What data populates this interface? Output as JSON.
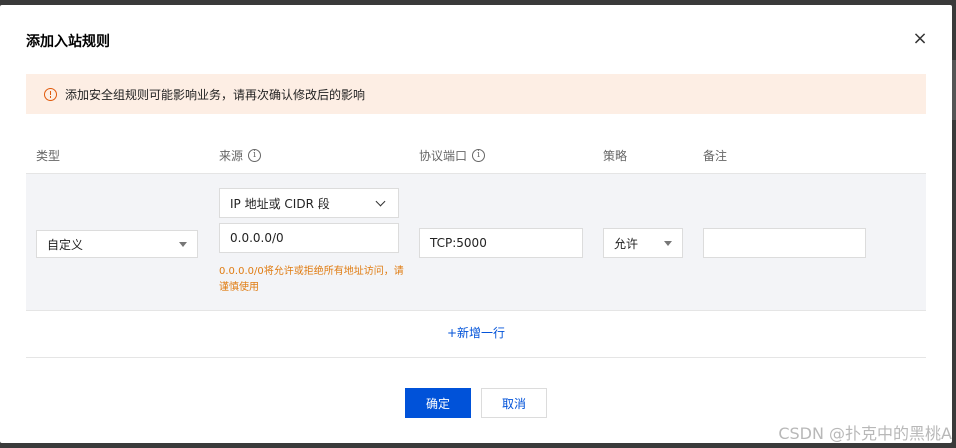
{
  "dialog": {
    "title": "添加入站规则",
    "close_symbol": "×"
  },
  "alert": {
    "icon": "warning-circle-icon",
    "text": "添加安全组规则可能影响业务，请再次确认修改后的影响",
    "color": "#e05a0c",
    "background": "#fdeee4"
  },
  "table": {
    "headers": {
      "type": "类型",
      "source": "来源",
      "port": "协议端口",
      "policy": "策略",
      "note": "备注"
    },
    "info_symbol": "i",
    "row": {
      "type_value": "自定义",
      "source_kind": "IP 地址或 CIDR 段",
      "source_value": "0.0.0.0/0",
      "source_warning": "0.0.0.0/0将允许或拒绝所有地址访问，请谨慎使用",
      "port_value": "TCP:5000",
      "policy_value": "允许",
      "note_value": ""
    }
  },
  "add_row_label": "+新增一行",
  "footer": {
    "ok_label": "确定",
    "cancel_label": "取消"
  },
  "watermark": "CSDN @扑克中的黑桃A",
  "colors": {
    "primary": "#0052d9",
    "warning_text": "#e07c12",
    "row_background": "#f3f4f7"
  }
}
